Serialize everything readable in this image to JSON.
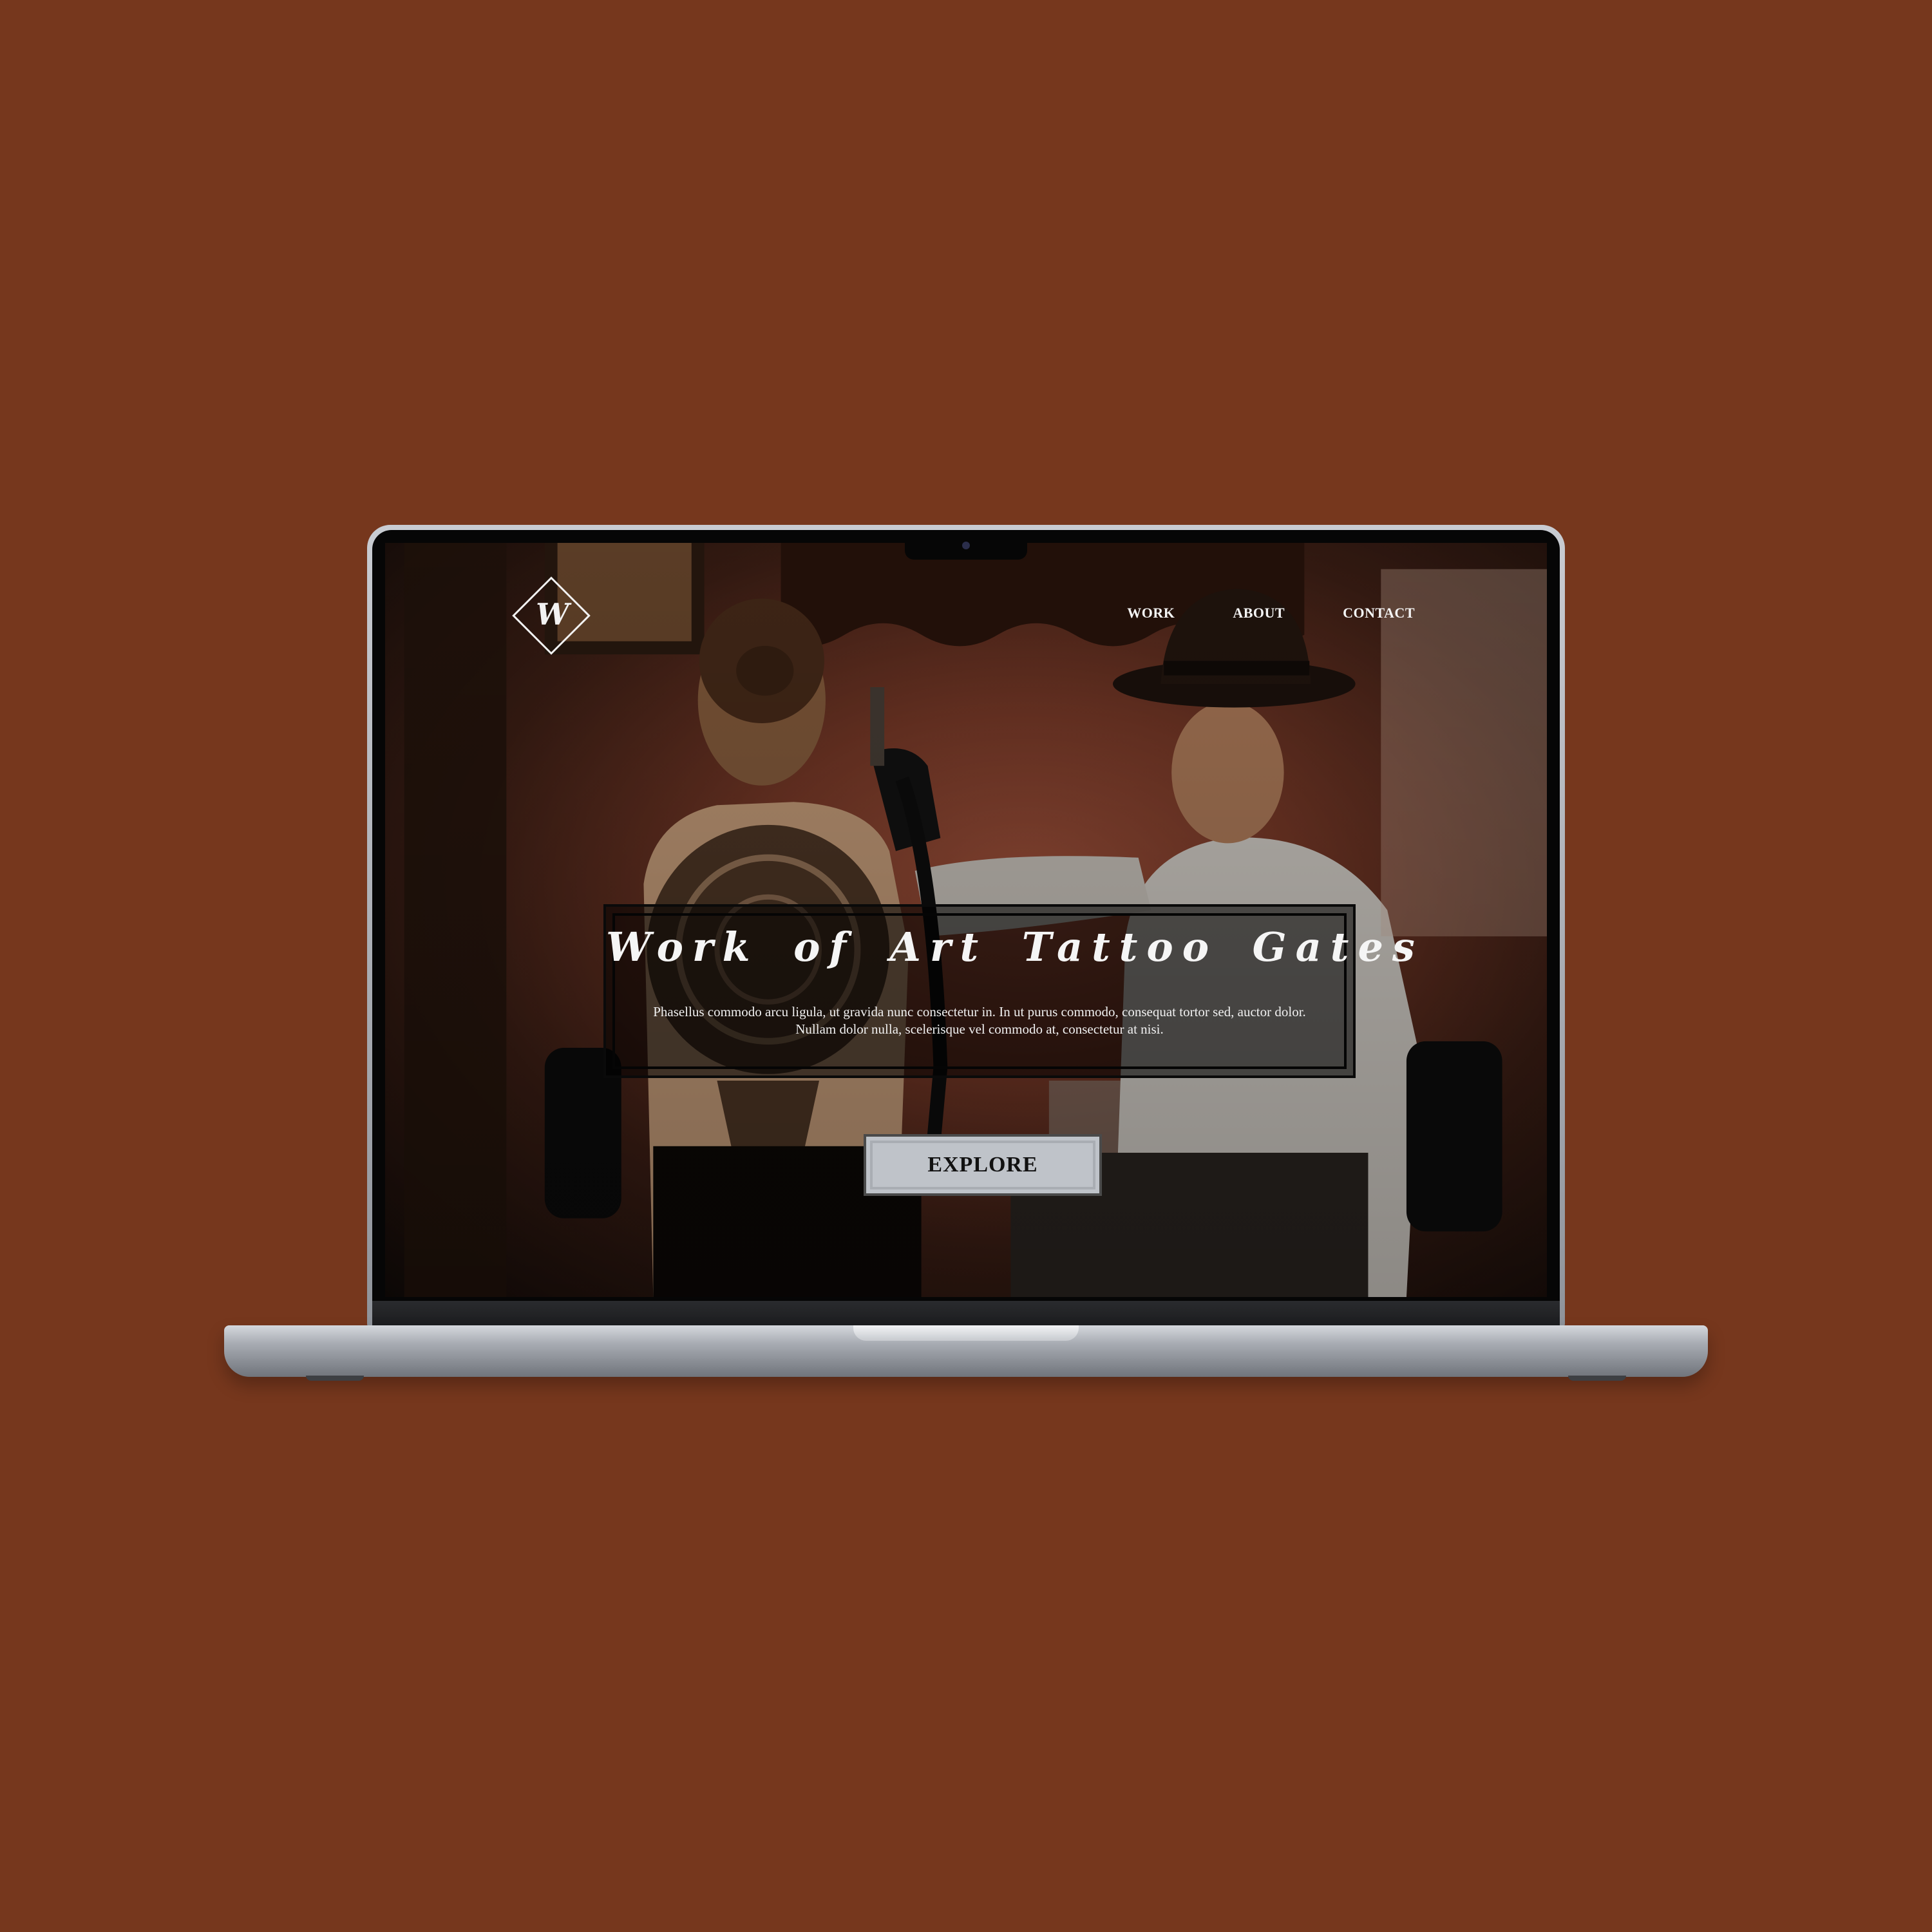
{
  "site": {
    "logo_letter": "W",
    "nav": {
      "work": "WORK",
      "about": "ABOUT",
      "contact": "CONTACT"
    },
    "hero": {
      "title": "Work of Art Tattoo Gates",
      "description": "Phasellus commodo arcu ligula, ut gravida nunc consectetur in. In ut purus commodo, consequat tortor sed, auctor dolor. Nullam dolor nulla, scelerisque vel commodo at, consectetur at nisi.",
      "button_label": "EXPLORE"
    }
  },
  "colors": {
    "background": "#76371d",
    "text": "#f5f5f5",
    "button_fill": "#bfc3c9"
  }
}
